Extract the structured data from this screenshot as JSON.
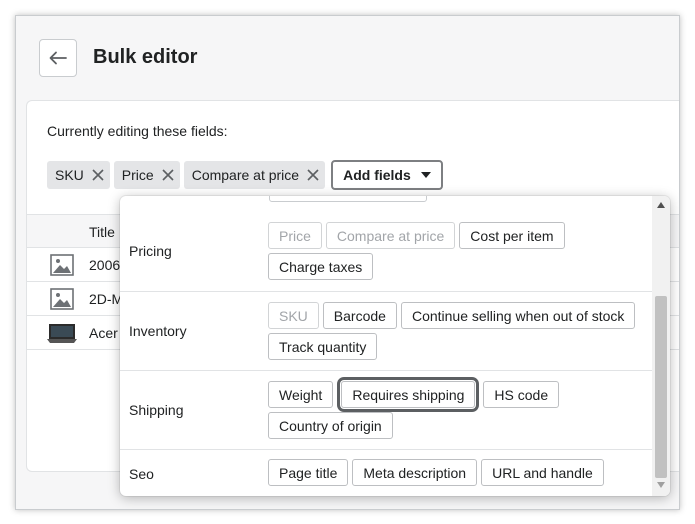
{
  "header": {
    "back_icon": "arrow-left-icon",
    "title": "Bulk editor"
  },
  "editor": {
    "editing_label": "Currently editing these fields:",
    "tags": [
      {
        "label": "SKU",
        "icon": "close-icon"
      },
      {
        "label": "Price",
        "icon": "close-icon"
      },
      {
        "label": "Compare at price",
        "icon": "close-icon"
      }
    ],
    "add_fields_label": "Add fields",
    "add_fields_icon": "caret-down-icon"
  },
  "table": {
    "column_title": "Title",
    "rows": [
      {
        "title": "2006",
        "thumb": "image-placeholder-icon"
      },
      {
        "title": "2D-M",
        "thumb": "image-placeholder-icon"
      },
      {
        "title": "Acer",
        "thumb": "product-photo"
      }
    ]
  },
  "dropdown": {
    "sections": [
      {
        "label": "Pricing",
        "options": [
          {
            "label": "Price",
            "state": "disabled"
          },
          {
            "label": "Compare at price",
            "state": "disabled"
          },
          {
            "label": "Cost per item",
            "state": "enabled"
          },
          {
            "label": "Charge taxes",
            "state": "enabled"
          }
        ]
      },
      {
        "label": "Inventory",
        "options": [
          {
            "label": "SKU",
            "state": "disabled"
          },
          {
            "label": "Barcode",
            "state": "enabled"
          },
          {
            "label": "Continue selling when out of stock",
            "state": "enabled"
          },
          {
            "label": "Track quantity",
            "state": "enabled"
          }
        ]
      },
      {
        "label": "Shipping",
        "options": [
          {
            "label": "Weight",
            "state": "enabled"
          },
          {
            "label": "Requires shipping",
            "state": "highlighted"
          },
          {
            "label": "HS code",
            "state": "enabled"
          },
          {
            "label": "Country of origin",
            "state": "enabled"
          }
        ]
      },
      {
        "label": "Seo",
        "options": [
          {
            "label": "Page title",
            "state": "enabled"
          },
          {
            "label": "Meta description",
            "state": "enabled"
          },
          {
            "label": "URL and handle",
            "state": "enabled"
          }
        ]
      }
    ]
  },
  "colors": {
    "text": "#202223",
    "disabled_text": "#a2a5a9",
    "tag_bg": "#e4e5e7",
    "highlight_outline": "#5c5f62"
  }
}
